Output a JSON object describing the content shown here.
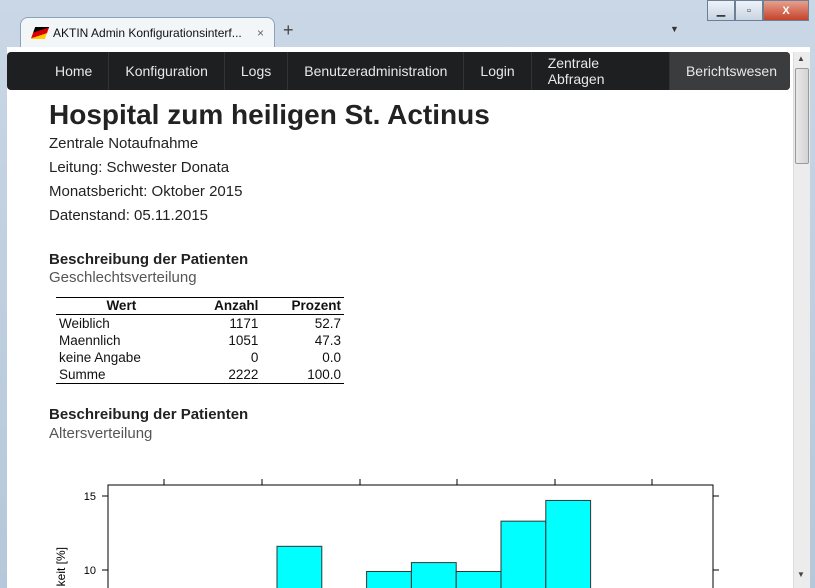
{
  "browser": {
    "tab_title": "AKTIN Admin Konfigurationsinterf...",
    "tab_close": "×",
    "new_tab": "+",
    "dropdown": "▼",
    "min": "▁",
    "max": "▫",
    "close": "X"
  },
  "nav": {
    "items": [
      "Home",
      "Konfiguration",
      "Logs",
      "Benutzeradministration",
      "Login",
      "Zentrale Abfragen",
      "Berichtswesen"
    ],
    "active": "Berichtswesen"
  },
  "report": {
    "title": "Hospital zum heiligen St. Actinus",
    "department": "Zentrale Notaufnahme",
    "lead": "Leitung: Schwester Donata",
    "period": "Monatsbericht: Oktober 2015",
    "data_date": "Datenstand: 05.11.2015"
  },
  "gender": {
    "section": "Beschreibung der Patienten",
    "subtitle": "Geschlechtsverteilung",
    "headers": [
      "Wert",
      "Anzahl",
      "Prozent"
    ],
    "rows": [
      [
        "Weiblich",
        "1171",
        "52.7"
      ],
      [
        "Maennlich",
        "1051",
        "47.3"
      ],
      [
        "keine Angabe",
        "0",
        "0.0"
      ],
      [
        "Summe",
        "2222",
        "100.0"
      ]
    ]
  },
  "age": {
    "section": "Beschreibung der Patienten",
    "subtitle": "Altersverteilung"
  },
  "chart_data": {
    "type": "bar",
    "ylabel": "keit [%]",
    "yticks": [
      10,
      15
    ],
    "yrange_visible": [
      9.3,
      15.8
    ],
    "bar_color": "#00ffff",
    "bars": [
      {
        "bin": 6,
        "value": 11.6
      },
      {
        "bin": 8,
        "value": 9.9
      },
      {
        "bin": 9,
        "value": 10.5
      },
      {
        "bin": 10,
        "value": 9.9
      },
      {
        "bin": 11,
        "value": 13.3
      },
      {
        "bin": 12,
        "value": 14.7
      }
    ]
  }
}
